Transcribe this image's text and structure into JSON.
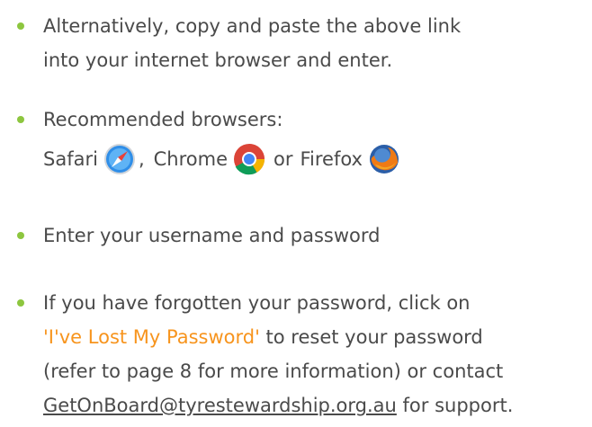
{
  "bullets": {
    "b1": {
      "line1": "Alternatively, copy and paste the above link",
      "line2": "into your internet browser and enter."
    },
    "b2": {
      "line1": "Recommended browsers:",
      "safari": "Safari",
      "sep1": ",",
      "chrome": "Chrome",
      "or_word": "or",
      "firefox": "Firefox"
    },
    "b3": {
      "line1": "Enter your username and password"
    },
    "b4": {
      "line1": "If you have forgotten your password, click on",
      "link_text": "'I've Lost My Password'",
      "line2_rest": " to reset your password",
      "line3": "(refer to page 8 for more information) or contact",
      "email": "GetOnBoard@tyrestewardship.org.au",
      "line4_rest": " for support."
    }
  },
  "colors": {
    "bullet": "#8dc63f",
    "highlight": "#f7941d",
    "text": "#4a4a4a"
  },
  "icons": {
    "safari": "safari-icon",
    "chrome": "chrome-icon",
    "firefox": "firefox-icon"
  }
}
